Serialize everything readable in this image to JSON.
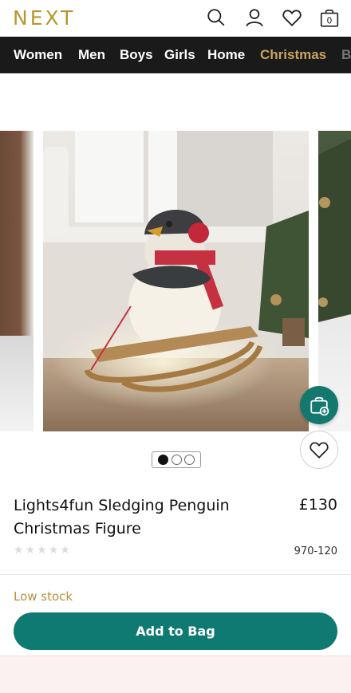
{
  "header": {
    "logo": "NEXT",
    "icons": [
      "search-icon",
      "account-icon",
      "wishlist-icon",
      "bag-icon"
    ],
    "bag_count": "0"
  },
  "nav": {
    "items": [
      {
        "label": "Women"
      },
      {
        "label": "Men"
      },
      {
        "label": "Boys"
      },
      {
        "label": "Girls"
      },
      {
        "label": "Home"
      },
      {
        "label": "Christmas"
      },
      {
        "label": "B"
      }
    ],
    "accent_color": "#c9a35e"
  },
  "gallery": {
    "slide_count": 3,
    "active_slide": 1
  },
  "product": {
    "title": "Lights4fun Sledging Penguin Christmas Figure",
    "price": "£130",
    "rating_stars": 0,
    "rating_max": 5,
    "sku": "970-120",
    "stock_status": "Low stock",
    "add_to_bag_label": "Add to Bag"
  },
  "colors": {
    "brand": "#b8962e",
    "primary_button": "#0f7a72",
    "stock": "#b8913f"
  }
}
